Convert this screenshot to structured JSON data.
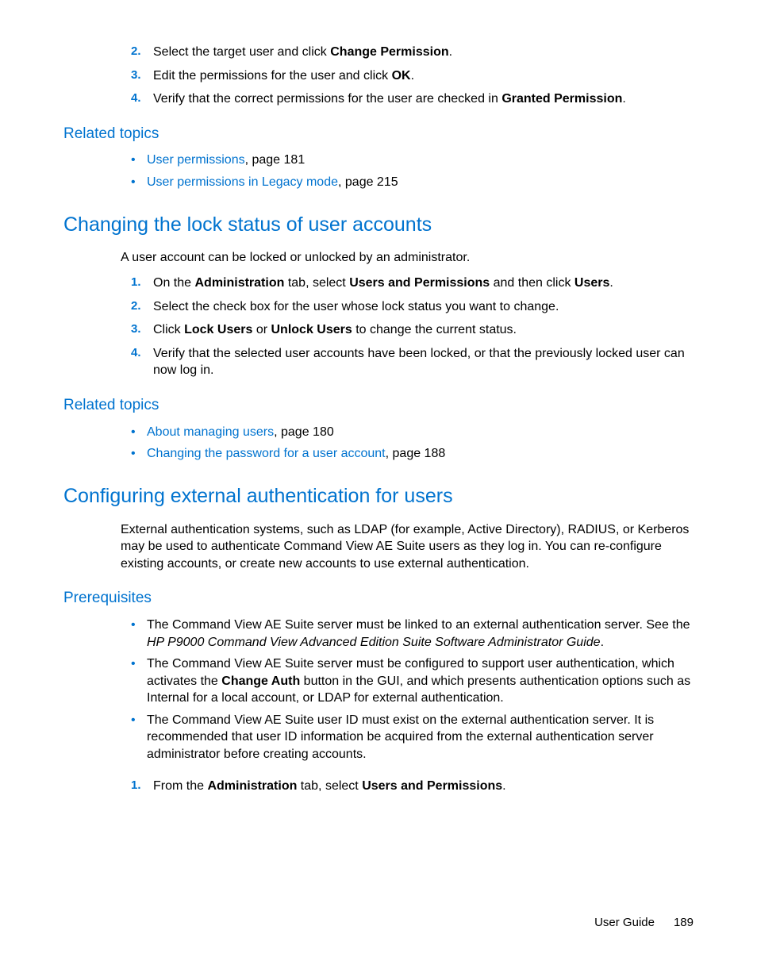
{
  "top_steps": [
    {
      "num": "2.",
      "pre": "Select the target user and click ",
      "bold": "Change Permission",
      "post": "."
    },
    {
      "num": "3.",
      "pre": "Edit the permissions for the user and click ",
      "bold": "OK",
      "post": "."
    },
    {
      "num": "4.",
      "pre": "Verify that the correct permissions for the user are checked in ",
      "bold": "Granted Permission",
      "post": "."
    }
  ],
  "related1": {
    "heading": "Related topics",
    "items": [
      {
        "link": "User permissions",
        "suffix": ", page 181"
      },
      {
        "link": "User permissions in Legacy mode",
        "suffix": ", page 215"
      }
    ]
  },
  "lock": {
    "heading": "Changing the lock status of user accounts",
    "intro": "A user account can be locked or unlocked by an administrator.",
    "steps": {
      "s1_num": "1.",
      "s1_a": "On the ",
      "s1_b": "Administration",
      "s1_c": " tab, select ",
      "s1_d": "Users and Permissions",
      "s1_e": " and then click ",
      "s1_f": "Users",
      "s1_g": ".",
      "s2_num": "2.",
      "s2_a": "Select the check box for the user whose lock status you want to change.",
      "s3_num": "3.",
      "s3_a": "Click ",
      "s3_b": "Lock Users",
      "s3_c": " or ",
      "s3_d": "Unlock Users",
      "s3_e": " to change the current status.",
      "s4_num": "4.",
      "s4_a": "Verify that the selected user accounts have been locked, or that the previously locked user can now log in."
    }
  },
  "related2": {
    "heading": "Related topics",
    "items": [
      {
        "link": "About managing users",
        "suffix": ", page 180"
      },
      {
        "link": "Changing the password for a user account",
        "suffix": ", page 188"
      }
    ]
  },
  "extauth": {
    "heading": "Configuring external authentication for users",
    "intro": "External authentication systems, such as LDAP (for example, Active Directory), RADIUS, or Kerberos may be used to authenticate Command View AE Suite users as they log in. You can re-configure existing accounts, or create new accounts to use external authentication."
  },
  "prereq": {
    "heading": "Prerequisites",
    "b1_a": "The Command View AE Suite server must be linked to an external authentication server. See the ",
    "b1_b": "HP P9000 Command View Advanced Edition Suite Software Administrator Guide",
    "b1_c": ".",
    "b2_a": "The Command View AE Suite server must be configured to support user authentication, which activates the ",
    "b2_b": "Change Auth",
    "b2_c": " button in the GUI, and which presents authentication options such as Internal for a local account, or LDAP for external authentication.",
    "b3": "The Command View AE Suite user ID must exist on the external authentication server. It is recommended that user ID information be acquired from the external authentication server administrator before creating accounts.",
    "s1_num": "1.",
    "s1_a": "From the ",
    "s1_b": "Administration",
    "s1_c": " tab, select ",
    "s1_d": "Users and Permissions",
    "s1_e": "."
  },
  "footer": {
    "label": "User Guide",
    "page": "189"
  }
}
